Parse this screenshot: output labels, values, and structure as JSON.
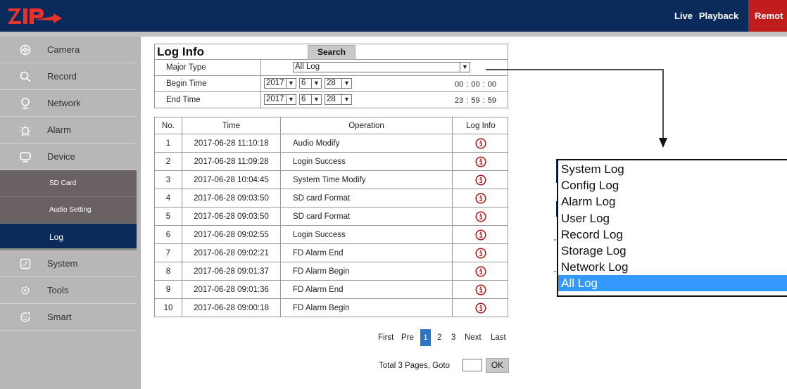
{
  "header": {
    "logo_text": "ZIP",
    "nav": {
      "live": "Live",
      "playback": "Playback",
      "remote": "Remot"
    }
  },
  "sidebar": {
    "items": [
      {
        "label": "Camera",
        "icon": "camera-icon"
      },
      {
        "label": "Record",
        "icon": "search-icon"
      },
      {
        "label": "Network",
        "icon": "network-icon"
      },
      {
        "label": "Alarm",
        "icon": "alarm-icon"
      },
      {
        "label": "Device",
        "icon": "device-icon"
      },
      {
        "label": "System",
        "icon": "system-icon"
      },
      {
        "label": "Tools",
        "icon": "tools-icon"
      },
      {
        "label": "Smart",
        "icon": "smart-icon"
      }
    ],
    "subitems": [
      {
        "label": "SD Card"
      },
      {
        "label": "Audio Setting"
      },
      {
        "label": "Log"
      }
    ],
    "active_subitem": "Log"
  },
  "log": {
    "title": "Log Info",
    "search_label": "Search",
    "filters": {
      "major_type_label": "Major Type",
      "major_type_value": "All Log",
      "begin_label": "Begin Time",
      "end_label": "End Time",
      "begin_year": "2017",
      "begin_month": "6",
      "begin_day": "28",
      "end_year": "2017",
      "end_month": "6",
      "end_day": "28",
      "begin_clock": "00 : 00 : 00",
      "end_clock": "23 : 59 : 59"
    },
    "columns": {
      "no": "No.",
      "time": "Time",
      "operation": "Operation",
      "info": "Log Info"
    },
    "rows": [
      {
        "no": "1",
        "time": "2017-06-28 11:10:18",
        "operation": "Audio Modify"
      },
      {
        "no": "2",
        "time": "2017-06-28 11:09:28",
        "operation": "Login Success"
      },
      {
        "no": "3",
        "time": "2017-06-28 10:04:45",
        "operation": "System Time Modify"
      },
      {
        "no": "4",
        "time": "2017-06-28 09:03:50",
        "operation": "SD card Format"
      },
      {
        "no": "5",
        "time": "2017-06-28 09:03:50",
        "operation": "SD card Format"
      },
      {
        "no": "6",
        "time": "2017-06-28 09:02:55",
        "operation": "Login Success"
      },
      {
        "no": "7",
        "time": "2017-06-28 09:02:21",
        "operation": "FD Alarm End"
      },
      {
        "no": "8",
        "time": "2017-06-28 09:01:37",
        "operation": "FD Alarm Begin"
      },
      {
        "no": "9",
        "time": "2017-06-28 09:01:36",
        "operation": "FD Alarm End"
      },
      {
        "no": "10",
        "time": "2017-06-28 09:00:18",
        "operation": "FD Alarm Begin"
      }
    ],
    "info_icon": "info-icon"
  },
  "pager": {
    "first": "First",
    "pre": "Pre",
    "pages": [
      "1",
      "2",
      "3"
    ],
    "current": "1",
    "next": "Next",
    "last": "Last",
    "total_text": "Total 3 Pages, Goto",
    "goto_value": "",
    "ok": "OK"
  },
  "dropdown_options": [
    "System Log",
    "Config Log",
    "Alarm Log",
    "User Log",
    "Record Log",
    "Storage Log",
    "Network Log",
    "All Log"
  ],
  "dropdown_selected": "All Log",
  "colors": {
    "topbar": "#0b2a5c",
    "remote_tab": "#c21d1d",
    "sidebar": "#b7b7b7",
    "submenu": "#6a6162",
    "active": "#0b2a5c",
    "info_icon": "#b01818",
    "page_current": "#2a75c7",
    "option_selected": "#3399ff"
  }
}
